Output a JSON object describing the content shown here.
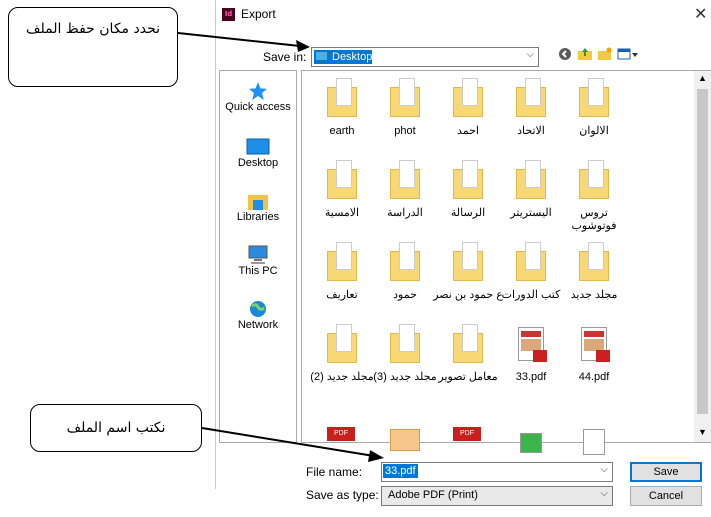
{
  "dialog": {
    "title": "Export",
    "app_icon_text": "Id",
    "close_glyph": "✕",
    "save_in_label": "Save in:",
    "save_in_value": "Desktop",
    "toolbar_icons": [
      "back-icon",
      "up-folder-icon",
      "new-folder-icon",
      "view-menu-icon"
    ]
  },
  "places": [
    {
      "label": "Quick access",
      "icon": "star-icon",
      "color": "#1e90ff"
    },
    {
      "label": "Desktop",
      "icon": "desktop-icon",
      "color": "#1e8ee6"
    },
    {
      "label": "Libraries",
      "icon": "library-icon",
      "color": "#f5c343"
    },
    {
      "label": "This PC",
      "icon": "computer-icon",
      "color": "#2b8ae0"
    },
    {
      "label": "Network",
      "icon": "globe-icon",
      "color": "#1c88d8"
    }
  ],
  "files": [
    {
      "name": "earth",
      "type": "folder"
    },
    {
      "name": "phot",
      "type": "folder"
    },
    {
      "name": "احمد",
      "type": "folder"
    },
    {
      "name": "الاتحاد",
      "type": "folder"
    },
    {
      "name": "الالوان",
      "type": "folder"
    },
    {
      "name": "الامسية",
      "type": "folder"
    },
    {
      "name": "الدراسة",
      "type": "folder"
    },
    {
      "name": "الرسالة",
      "type": "folder"
    },
    {
      "name": "اليستريتر",
      "type": "folder"
    },
    {
      "name": "تروس فوتوشوب",
      "type": "folder"
    },
    {
      "name": "تعاريف",
      "type": "folder"
    },
    {
      "name": "حمود",
      "type": "folder"
    },
    {
      "name": "ع حمود بن نصر",
      "type": "folder"
    },
    {
      "name": "كتب الدورات",
      "type": "folder"
    },
    {
      "name": "مجلد جديد",
      "type": "folder"
    },
    {
      "name": "مجلد جديد (2)",
      "type": "folder"
    },
    {
      "name": "مجلد جديد (3)",
      "type": "folder"
    },
    {
      "name": "معامل تصوير",
      "type": "folder"
    },
    {
      "name": "33.pdf",
      "type": "pdf"
    },
    {
      "name": "44.pdf",
      "type": "pdf"
    }
  ],
  "bottom_row_badges": [
    "PDF",
    "PDF"
  ],
  "form": {
    "file_name_label": "File name:",
    "file_name_value": "33.pdf",
    "save_as_type_label": "Save as type:",
    "save_as_type_value": "Adobe PDF (Print)",
    "save_button": "Save",
    "cancel_button": "Cancel"
  },
  "annotations": {
    "callout_location": "نحدد مكان حفظ الملف",
    "callout_filename": "نكتب اسم الملف"
  },
  "colors": {
    "accent": "#0078d7",
    "folder": "#f8d775",
    "pdf_red": "#cc1f1f"
  }
}
